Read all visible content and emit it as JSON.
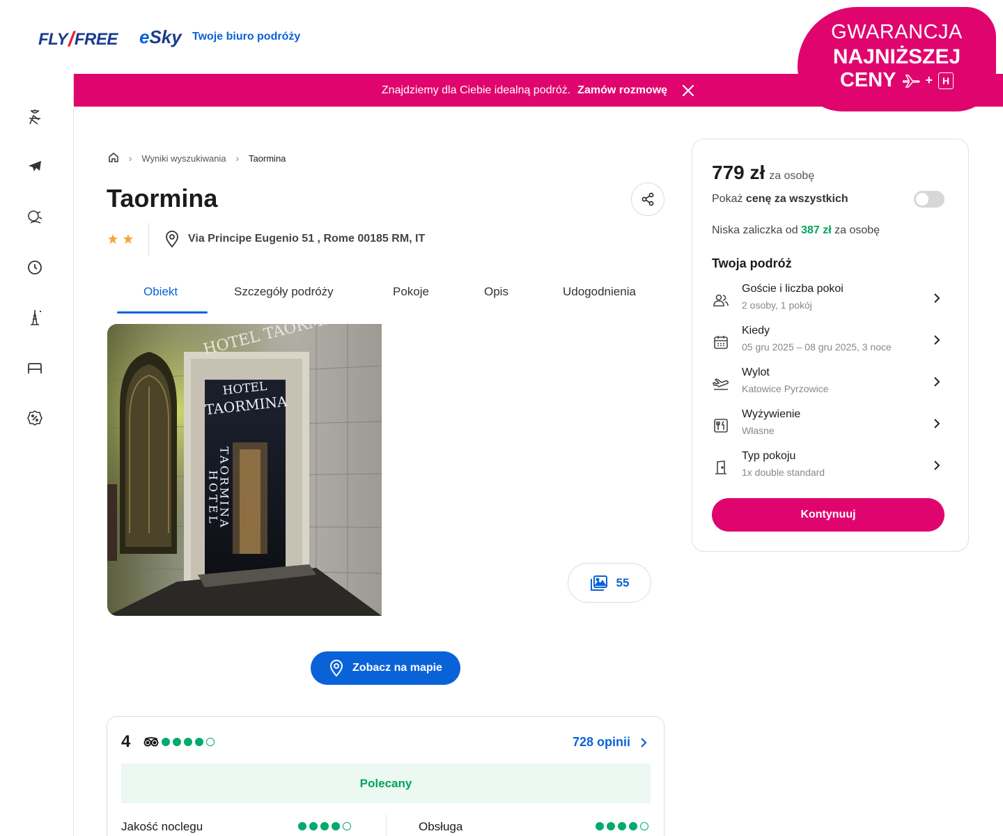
{
  "header": {
    "logo_flyfree_left": "FLY",
    "logo_flyfree_right": "FREE",
    "logo_esky_e": "e",
    "logo_esky_rest": "Sky",
    "tagline": "Twoje biuro podróży",
    "badge_line1": "GWARANCJA",
    "badge_line2": "NAJNIŻSZEJ",
    "badge_line3": "CENY",
    "badge_plus": "+",
    "badge_hotel_letter": "H"
  },
  "banner": {
    "text": "Znajdziemy dla Ciebie idealną podróż.",
    "link": "Zamów rozmowę",
    "close_icon": "close-icon"
  },
  "rail": {
    "icons": [
      "beach-chair-icon",
      "plane-icon",
      "island-icon",
      "last-minute-clock-icon",
      "eiffel-tower-icon",
      "bed-icon",
      "discount-badge-icon"
    ]
  },
  "breadcrumb": {
    "home_icon": "home-icon",
    "items": [
      "Wyniki wyszukiwania",
      "Taormina"
    ]
  },
  "hotel": {
    "name": "Taormina",
    "stars": 2,
    "address": "Via Principe Eugenio 51 , Rome 00185 RM, IT"
  },
  "tabs": [
    "Obiekt",
    "Szczegóły podróży",
    "Pokoje",
    "Opis",
    "Udogodnienia"
  ],
  "photo": {
    "sign_line1": "HOTEL",
    "sign_line2": "TAORMINA",
    "vertical_left": "HOTEL",
    "vertical_right": "TAORMINA",
    "arch_text": "HOTEL TAORMINA"
  },
  "gallery": {
    "count": "55"
  },
  "map_button": {
    "label": "Zobacz na mapie"
  },
  "reviews": {
    "score": "4",
    "bubbles_filled": 4,
    "count_label": "728 opinii",
    "recommendation": "Polecany",
    "rows": [
      {
        "label": "Jakość noclegu",
        "filled": 4
      },
      {
        "label": "Obsługa",
        "filled": 4
      }
    ]
  },
  "booking": {
    "price": "779 zł",
    "per_person": "za osobę",
    "toggle_prefix": "Pokaż",
    "toggle_bold": "cenę za wszystkich",
    "deposit_prefix": "Niska zaliczka od",
    "deposit_amount": "387 zł",
    "deposit_suffix": "za osobę",
    "trip_heading": "Twoja podróż",
    "options": [
      {
        "label": "Goście i liczba pokoi",
        "value": "2 osoby, 1 pokój",
        "icon": "guests-icon"
      },
      {
        "label": "Kiedy",
        "value": "05 gru 2025 – 08 gru 2025, 3 noce",
        "icon": "calendar-icon"
      },
      {
        "label": "Wylot",
        "value": "Katowice Pyrzowice",
        "icon": "departure-icon"
      },
      {
        "label": "Wyżywienie",
        "value": "Własne",
        "icon": "meal-icon"
      },
      {
        "label": "Typ pokoju",
        "value": "1x double standard",
        "icon": "door-icon"
      }
    ],
    "cta": "Kontynuuj"
  },
  "colors": {
    "brand_pink": "#e0056e",
    "brand_blue": "#0a62d8",
    "green": "#00aa6c"
  }
}
